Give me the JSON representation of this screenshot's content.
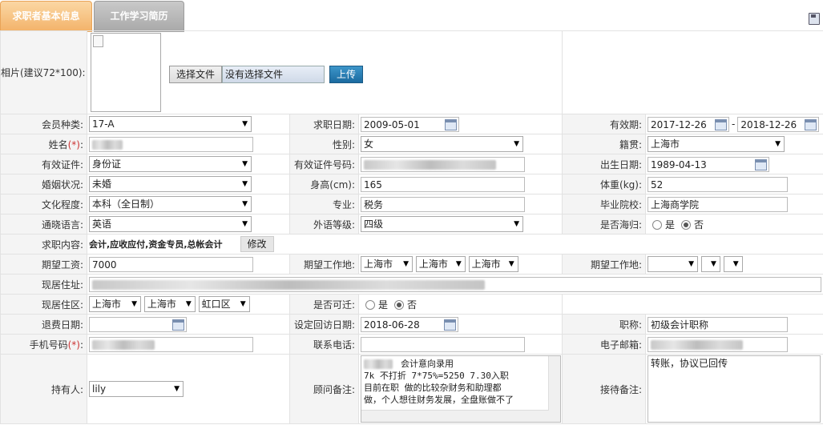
{
  "tabs": {
    "basic": "求职者基本信息",
    "work": "工作学习简历"
  },
  "photo": {
    "label": "相片(建议72*100):",
    "choose_btn": "选择文件",
    "no_file": "没有选择文件",
    "upload_btn": "上传"
  },
  "row_member": {
    "label": "会员种类:",
    "value": "17-A",
    "apply_label": "求职日期:",
    "apply_date": "2009-05-01",
    "valid_label": "有效期:",
    "valid_from": "2017-12-26",
    "valid_sep": "-",
    "valid_to": "2018-12-26"
  },
  "row_name": {
    "label": "姓名",
    "req": "(*)",
    "colon": ":",
    "gender_label": "性别:",
    "gender": "女",
    "native_label": "籍贯:",
    "native": "上海市"
  },
  "row_cert": {
    "label": "有效证件:",
    "value": "身份证",
    "cert_no_label": "有效证件号码:",
    "birth_label": "出生日期:",
    "birth": "1989-04-13"
  },
  "row_marry": {
    "label": "婚姻状况:",
    "value": "未婚",
    "height_label": "身高(cm):",
    "height": "165",
    "weight_label": "体重(kg):",
    "weight": "52"
  },
  "row_edu": {
    "label": "文化程度:",
    "value": "本科（全日制）",
    "major_label": "专业:",
    "major": "税务",
    "school_label": "毕业院校:",
    "school": "上海商学院"
  },
  "row_lang": {
    "label": "通晓语言:",
    "value": "英语",
    "level_label": "外语等级:",
    "level": "四级",
    "overseas_label": "是否海归:",
    "yes": "是",
    "no": "否",
    "overseas_selected": "否"
  },
  "row_job": {
    "label": "求职内容:",
    "value": "会计,应收应付,资金专员,总帐会计",
    "edit_btn": "修改"
  },
  "row_salary": {
    "label": "期望工资:",
    "value": "7000",
    "loc_label": "期望工作地:",
    "loc": [
      "上海市",
      "上海市",
      "上海市"
    ],
    "loc2_label": "期望工作地:"
  },
  "row_addr": {
    "label": "现居住址:"
  },
  "row_area": {
    "label": "现居住区:",
    "area": [
      "上海市",
      "上海市",
      "虹口区"
    ],
    "move_label": "是否可迁:",
    "yes": "是",
    "no": "否",
    "move_selected": "否"
  },
  "row_refund": {
    "label": "退费日期:",
    "visit_label": "设定回访日期:",
    "visit": "2018-06-28",
    "title_label": "职称:",
    "title": "初级会计职称"
  },
  "row_phone": {
    "label": "手机号码",
    "req": "(*)",
    "colon": ":",
    "contact_label": "联系电话:",
    "email_label": "电子邮箱:"
  },
  "row_owner": {
    "label": "持有人:",
    "owner": "lily",
    "note_label": "顾问备注:",
    "note_lines": [
      "会计意向录用",
      "7k 不打折 7*75%=5250  7.30入职",
      "目前在职 做的比较杂财务和助理都",
      "做，个人想往财务发展，全盘账做不了"
    ],
    "recv_label": "接待备注:",
    "recv": "转账，协议已回传"
  },
  "colors": {
    "tab_active": "#f3b36a",
    "tab_inactive": "#a9a9a9",
    "label_bg": "#f4f4f4",
    "upload_btn": "#1b6ba0"
  }
}
